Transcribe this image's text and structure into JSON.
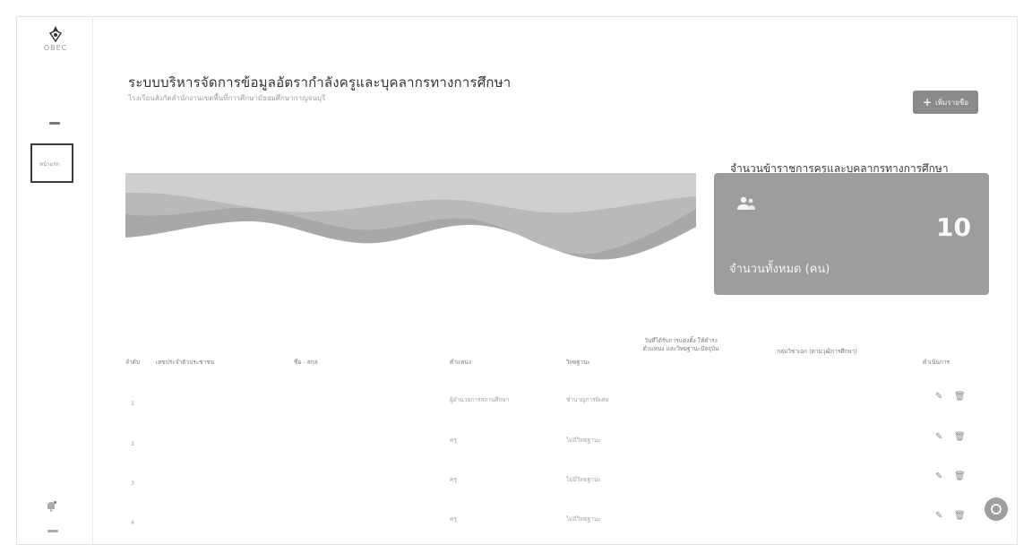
{
  "app": {
    "logo_text": "OBEC"
  },
  "sidebar": {
    "nav_home_label": "หน้าแรก"
  },
  "header": {
    "title": "ระบบบริหารจัดการข้อมูลอัตรากำลังครูและบุคลากรทางการศึกษา",
    "subtitle": "โรงเรียนสังกัดสำนักงานเขตพื้นที่การศึกษามัธยมศึกษากาญจนบุรี",
    "add_button_label": "เพิ่มรายชื่อ"
  },
  "stats": {
    "heading": "จำนวนข้าราชการครูและบุคลากรทางการศึกษา",
    "total_value": "10",
    "total_label": "จำนวนทั้งหมด (คน)"
  },
  "table": {
    "columns": [
      "ลำดับ",
      "เลขประจำตัวประชาชน",
      "ชื่อ - สกุล",
      "ตำแหน่ง",
      "วิทยฐานะ",
      "วันที่ได้รับการแต่งตั้ง ให้ดำรงตำแหน่ง และวิทยฐานะปัจจุบัน",
      "กลุ่มวิชาเอก (ตามวุฒิการศึกษา)",
      "ดำเนินการ"
    ],
    "rows": [
      {
        "no": "1",
        "position": "ผู้อำนวยการสถานศึกษา",
        "rank": "ชำนาญการพิเศษ"
      },
      {
        "no": "2",
        "position": "ครู",
        "rank": "ไม่มีวิทยฐานะ"
      },
      {
        "no": "3",
        "position": "ครู",
        "rank": "ไม่มีวิทยฐานะ"
      },
      {
        "no": "4",
        "position": "ครู",
        "rank": "ไม่มีวิทยฐานะ"
      }
    ]
  },
  "icons": {
    "logo": "school-emblem-icon",
    "bell": "bell-icon",
    "edit": "edit-icon",
    "delete": "trash-icon",
    "help": "help-icon",
    "add": "plus-icon",
    "people": "users-icon"
  }
}
